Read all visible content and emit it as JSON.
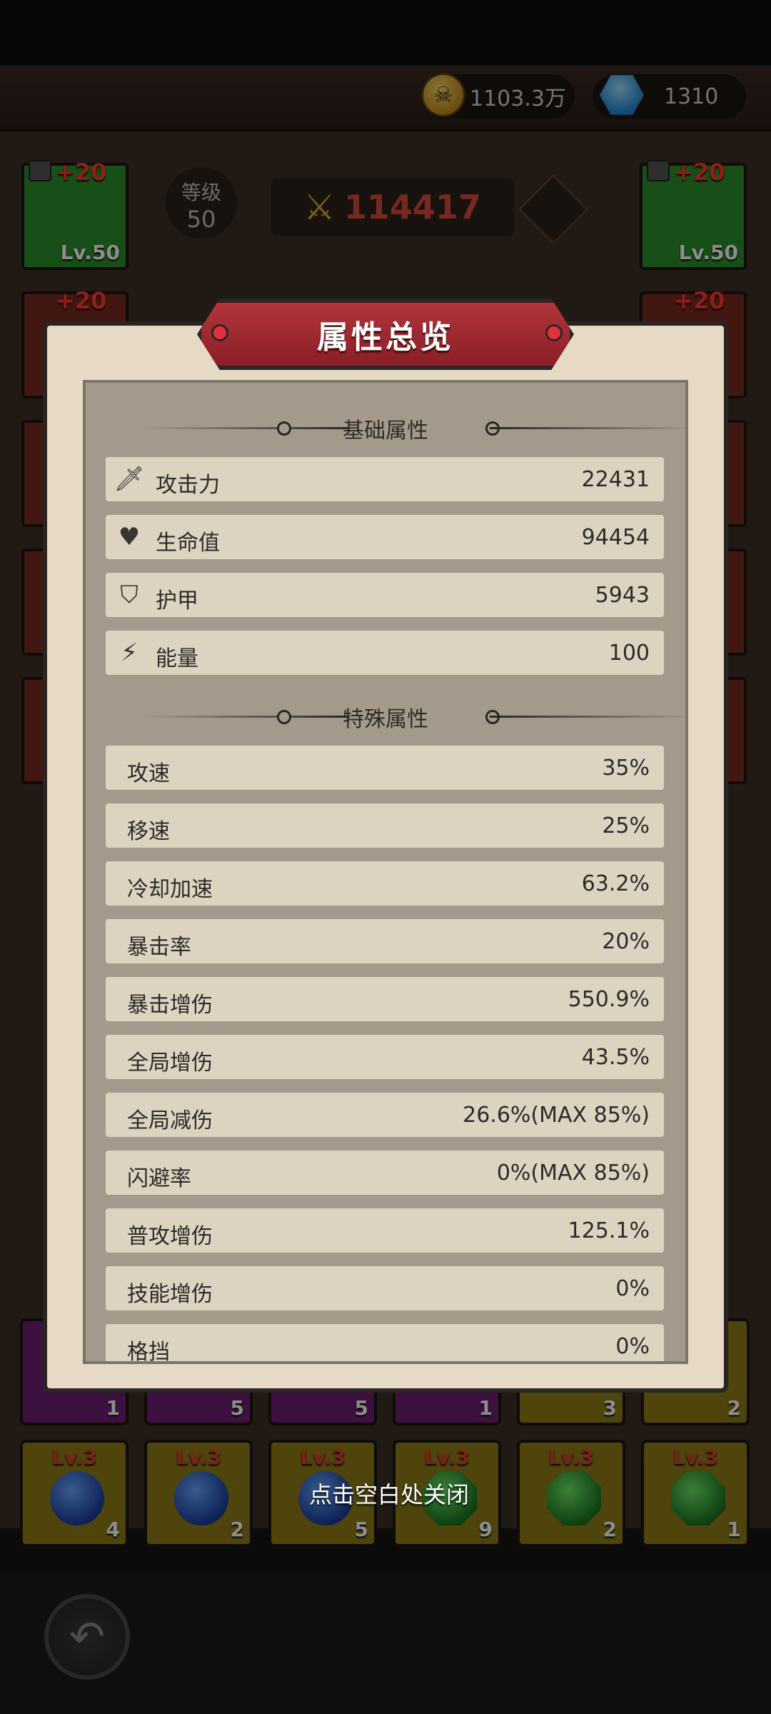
{
  "currency": {
    "gold": "1103.3万",
    "gems": "1310"
  },
  "hero": {
    "level_label": "等级",
    "level_value": "50",
    "power": "114417"
  },
  "equip_slots": [
    {
      "level": "Lv.50",
      "bonus": "+20"
    },
    {
      "level": "Lv.50",
      "bonus": "+20"
    },
    {
      "bonus": "+20"
    },
    {
      "bonus": "+20"
    }
  ],
  "gem_row_counts": [
    "1",
    "5",
    "5",
    "1",
    "3",
    "2"
  ],
  "gem_slots": [
    {
      "level": "Lv.3",
      "count": "4"
    },
    {
      "level": "Lv.3",
      "count": "2"
    },
    {
      "level": "Lv.3",
      "count": "5"
    },
    {
      "level": "Lv.3",
      "count": "9"
    },
    {
      "level": "Lv.3",
      "count": "2"
    },
    {
      "level": "Lv.3",
      "count": "1"
    }
  ],
  "modal": {
    "title": "属性总览",
    "basic_section": "基础属性",
    "special_section": "特殊属性",
    "basic_attributes": [
      {
        "icon": "sword-icon",
        "label": "攻击力",
        "value": "22431"
      },
      {
        "icon": "heart-icon",
        "label": "生命值",
        "value": "94454"
      },
      {
        "icon": "shield-icon",
        "label": "护甲",
        "value": "5943"
      },
      {
        "icon": "lightning-icon",
        "label": "能量",
        "value": "100"
      }
    ],
    "special_attributes": [
      {
        "label": "攻速",
        "value": "35%"
      },
      {
        "label": "移速",
        "value": "25%"
      },
      {
        "label": "冷却加速",
        "value": "63.2%"
      },
      {
        "label": "暴击率",
        "value": "20%"
      },
      {
        "label": "暴击增伤",
        "value": "550.9%"
      },
      {
        "label": "全局增伤",
        "value": "43.5%"
      },
      {
        "label": "全局减伤",
        "value": "26.6%(MAX 85%)"
      },
      {
        "label": "闪避率",
        "value": "0%(MAX 85%)"
      },
      {
        "label": "普攻增伤",
        "value": "125.1%"
      },
      {
        "label": "技能增伤",
        "value": "0%"
      },
      {
        "label": "格挡",
        "value": "0%"
      }
    ]
  },
  "close_hint": "点击空白处关闭"
}
